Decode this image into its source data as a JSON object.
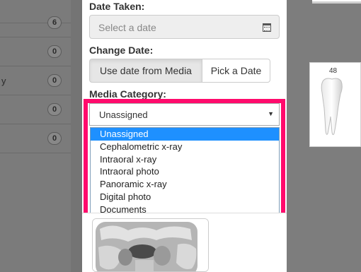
{
  "sidebar": {
    "items": [
      {
        "label": "",
        "count": "6"
      },
      {
        "label": "",
        "count": "0"
      },
      {
        "label": "y",
        "count": "0"
      },
      {
        "label": "",
        "count": "0"
      },
      {
        "label": "",
        "count": "0"
      }
    ]
  },
  "form": {
    "date_taken_label": "Date Taken:",
    "date_placeholder": "Select a date",
    "change_date_label": "Change Date:",
    "use_media_label": "Use date from Media",
    "pick_date_label": "Pick a Date",
    "media_category_label": "Media Category:",
    "selected_category": "Unassigned",
    "category_options": [
      "Unassigned",
      "Cephalometric x-ray",
      "Intraoral x-ray",
      "Intraoral photo",
      "Panoramic x-ray",
      "Digital photo",
      "Documents"
    ]
  },
  "preview": {
    "tooth_number": "48"
  },
  "colors": {
    "highlight": "#ff0a6c",
    "selected_option": "#1e90ff"
  },
  "icons": [
    "calendar-icon",
    "chevron-down-icon",
    "tooth-icon"
  ]
}
